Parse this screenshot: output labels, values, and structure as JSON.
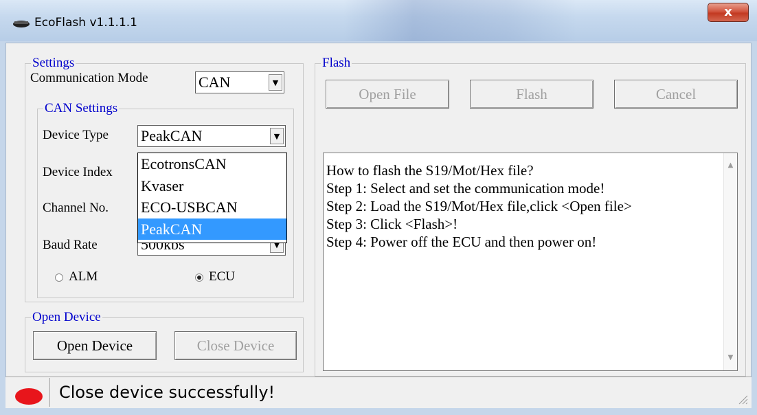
{
  "window": {
    "title": "EcoFlash v1.1.1.1",
    "close_label": "x"
  },
  "settings": {
    "legend": "Settings",
    "comm_mode_label": "Communication Mode",
    "comm_mode_value": "CAN"
  },
  "can_settings": {
    "legend": "CAN Settings",
    "device_type_label": "Device Type",
    "device_type_value": "PeakCAN",
    "device_index_label": "Device Index",
    "channel_label": "Channel No.",
    "baud_label": "Baud Rate",
    "baud_value": "500kbs",
    "dropdown_options": [
      "EcotronsCAN",
      "Kvaser",
      "ECO-USBCAN",
      "PeakCAN"
    ],
    "dropdown_selected": "PeakCAN",
    "radio_alm_label": "ALM",
    "radio_ecu_label": "ECU",
    "radio_selected": "ECU"
  },
  "open_device": {
    "legend": "Open Device",
    "open_label": "Open Device",
    "close_label": "Close Device"
  },
  "flash": {
    "legend": "Flash",
    "open_file_label": "Open File",
    "flash_label": "Flash",
    "cancel_label": "Cancel",
    "instructions": [
      "How to flash the S19/Mot/Hex file?",
      "Step 1: Select and set the communication mode!",
      "Step 2: Load the S19/Mot/Hex file,click <Open file>",
      "Step 3: Click <Flash>!",
      "Step 4: Power off the ECU and then power on!"
    ]
  },
  "status": {
    "text": "Close device successfully!",
    "led_color": "#e8151b"
  },
  "icons": {
    "close": "close-icon",
    "app": "chip-icon",
    "dropdown": "chevron-down-icon"
  }
}
